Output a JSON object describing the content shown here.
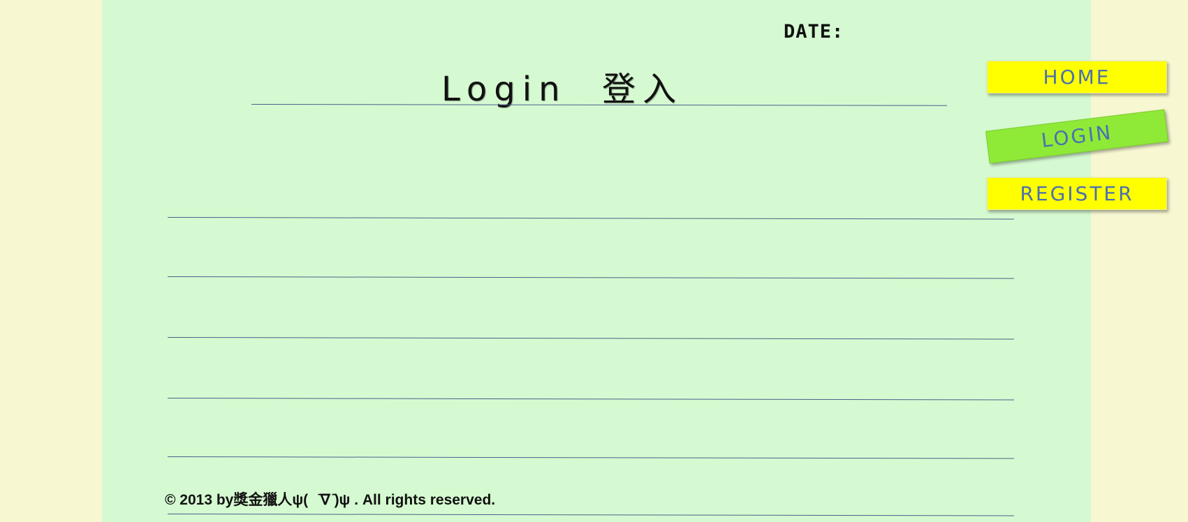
{
  "header": {
    "date_label": "DATE:",
    "title": "Login  登入"
  },
  "nav": {
    "home_label": "HOME",
    "login_label": "LOGIN",
    "register_label": "REGISTER"
  },
  "footer": {
    "copyright": "© 2013 by獎金獵人ψ(   ̄∇ ̄)ψ . All rights reserved."
  },
  "colors": {
    "page_background": "#f7f7d2",
    "paper_background": "#d5fad1",
    "rule_line": "#4a5f8a",
    "nav_default": "#ffff00",
    "nav_active": "#8fea38",
    "nav_text": "#4a6fb0"
  }
}
